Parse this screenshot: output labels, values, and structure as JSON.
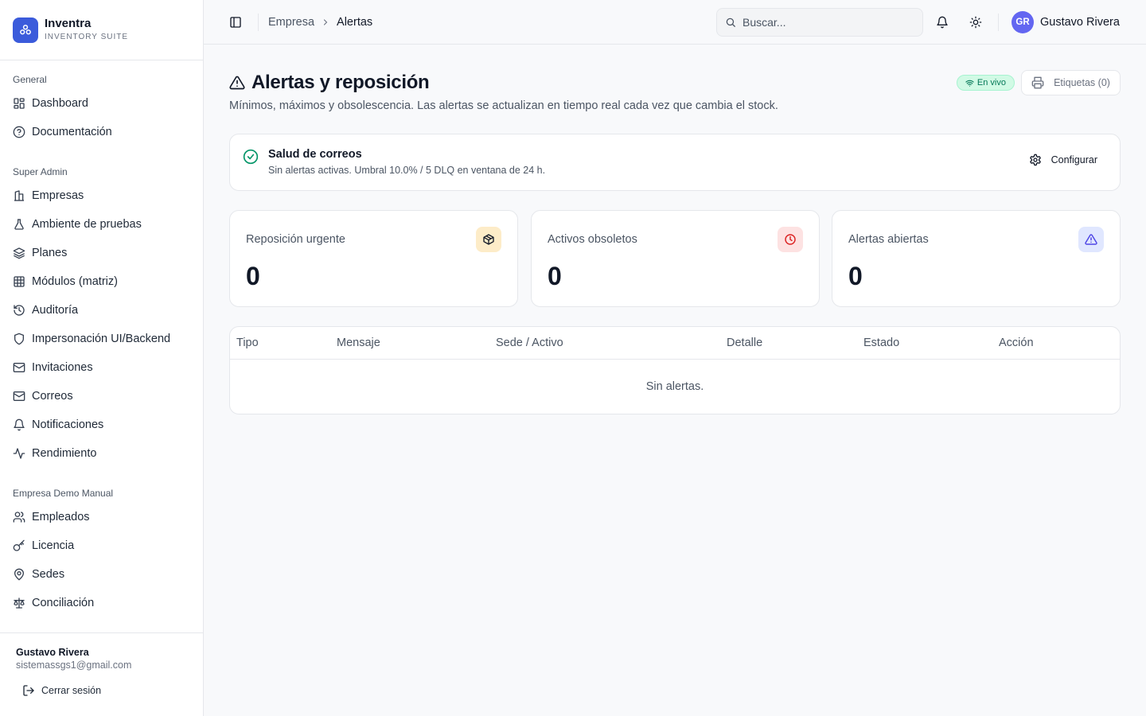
{
  "app": {
    "name": "Inventra",
    "subtitle": "INVENTORY SUITE",
    "brand_color": "#3b5bdb"
  },
  "sidebar": {
    "groups": [
      {
        "title": "General",
        "items": [
          {
            "label": "Dashboard",
            "icon": "layout-grid-icon"
          },
          {
            "label": "Documentación",
            "icon": "help-circle-icon"
          }
        ]
      },
      {
        "title": "Super Admin",
        "items": [
          {
            "label": "Empresas",
            "icon": "building-icon"
          },
          {
            "label": "Ambiente de pruebas",
            "icon": "flask-icon"
          },
          {
            "label": "Planes",
            "icon": "layers-icon"
          },
          {
            "label": "Módulos (matriz)",
            "icon": "table-icon"
          },
          {
            "label": "Auditoría",
            "icon": "history-icon"
          },
          {
            "label": "Impersonación UI/Backend",
            "icon": "shield-icon"
          },
          {
            "label": "Invitaciones",
            "icon": "mail-icon"
          },
          {
            "label": "Correos",
            "icon": "mail-icon"
          },
          {
            "label": "Notificaciones",
            "icon": "bell-icon"
          },
          {
            "label": "Rendimiento",
            "icon": "activity-icon"
          }
        ]
      },
      {
        "title": "Empresa Demo Manual",
        "items": [
          {
            "label": "Empleados",
            "icon": "users-icon"
          },
          {
            "label": "Licencia",
            "icon": "key-icon"
          },
          {
            "label": "Sedes",
            "icon": "map-pin-icon"
          },
          {
            "label": "Conciliación",
            "icon": "scale-icon"
          }
        ]
      }
    ],
    "footer": {
      "user_name": "Gustavo Rivera",
      "user_email": "sistemassgs1@gmail.com",
      "logout_label": "Cerrar sesión"
    }
  },
  "topbar": {
    "breadcrumb": {
      "parent": "Empresa",
      "current": "Alertas"
    },
    "search_placeholder": "Buscar...",
    "user": {
      "initials": "GR",
      "name": "Gustavo Rivera",
      "avatar_color": "#6366f1"
    }
  },
  "page": {
    "title": "Alertas y reposición",
    "description": "Mínimos, máximos y obsolescencia. Las alertas se actualizan en tiempo real cada vez que cambia el stock.",
    "live_badge": "En vivo",
    "labels_button": "Etiquetas (0)"
  },
  "mail_health": {
    "title": "Salud de correos",
    "description": "Sin alertas activas. Umbral 10.0% / 5 DLQ en ventana de 24 h.",
    "configure_label": "Configurar",
    "status_color": "#059669"
  },
  "stats": [
    {
      "label": "Reposición urgente",
      "value": "0",
      "icon": "package-icon",
      "bg": "#fdecc8",
      "fg": "#b45309"
    },
    {
      "label": "Activos obsoletos",
      "value": "0",
      "icon": "clock-icon",
      "bg": "#fde2e2",
      "fg": "#dc2626"
    },
    {
      "label": "Alertas abiertas",
      "value": "0",
      "icon": "alert-triangle-icon",
      "bg": "#e0e7ff",
      "fg": "#4f46e5"
    }
  ],
  "table": {
    "columns": [
      "Tipo",
      "Mensaje",
      "Sede / Activo",
      "Detalle",
      "Estado",
      "Acción"
    ],
    "empty_message": "Sin alertas."
  }
}
